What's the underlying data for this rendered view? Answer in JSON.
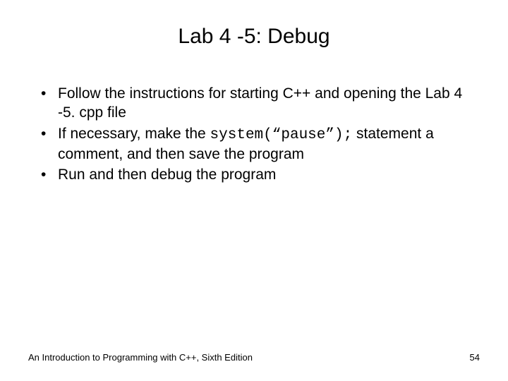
{
  "title": "Lab 4 -5: Debug",
  "bullets": [
    {
      "prefix": "Follow the instructions for starting C++ and opening the Lab 4 -5. cpp file",
      "code": "",
      "suffix": ""
    },
    {
      "prefix": "If necessary, make the ",
      "code": "system(“pause”);",
      "suffix": " statement a comment, and then save the program"
    },
    {
      "prefix": "Run and then debug the program",
      "code": "",
      "suffix": ""
    }
  ],
  "footer": {
    "left": "An Introduction to Programming with C++, Sixth Edition",
    "right": "54"
  }
}
